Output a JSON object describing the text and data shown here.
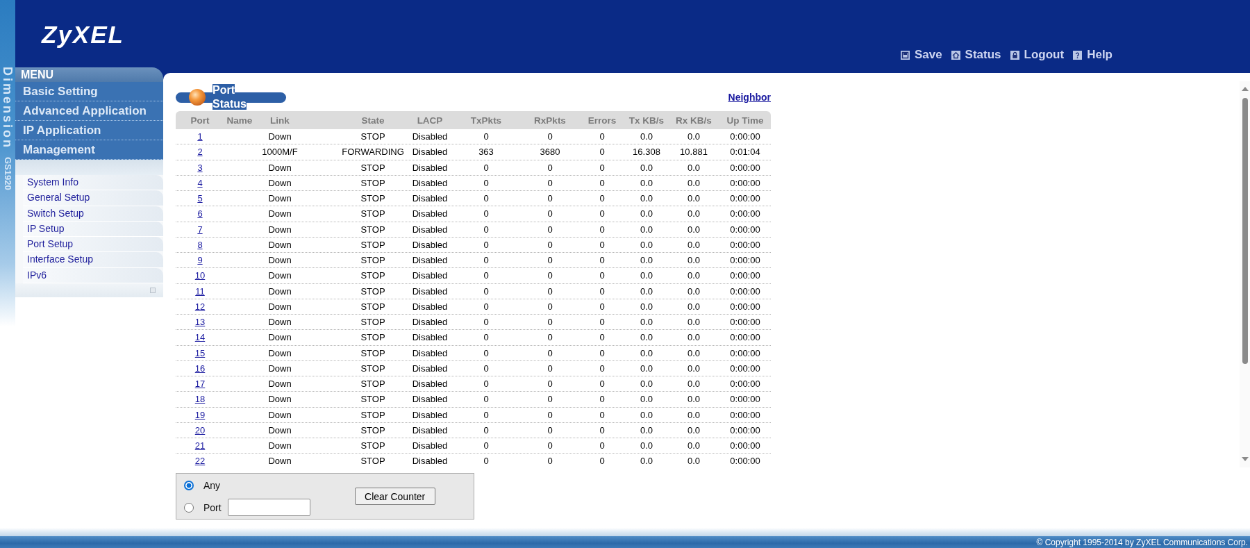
{
  "header": {
    "logo": "ZyXEL",
    "brand_strip": {
      "product": "Dimension",
      "model": "GS1920"
    },
    "actions": [
      {
        "kind": "save",
        "label": "Save"
      },
      {
        "kind": "status",
        "label": "Status"
      },
      {
        "kind": "logout",
        "label": "Logout"
      },
      {
        "kind": "help",
        "label": "Help"
      }
    ]
  },
  "sidebar": {
    "heading": "MENU",
    "sections": [
      "Basic Setting",
      "Advanced Application",
      "IP Application",
      "Management"
    ],
    "items": [
      "System Info",
      "General Setup",
      "Switch Setup",
      "IP Setup",
      "Port Setup",
      "Interface Setup",
      "IPv6"
    ]
  },
  "panel": {
    "title": "Port Status",
    "link": "Neighbor"
  },
  "table": {
    "columns": [
      "Port",
      "Name",
      "Link",
      "State",
      "LACP",
      "TxPkts",
      "RxPkts",
      "Errors",
      "Tx KB/s",
      "Rx KB/s",
      "Up Time"
    ],
    "rows": [
      {
        "port": "1",
        "link": "Down",
        "state": "STOP",
        "lacp": "Disabled",
        "tx_pkts": "0",
        "rx_pkts": "0",
        "errors": "0",
        "tx_kbs": "0.0",
        "rx_kbs": "0.0",
        "up_time": "0:00:00"
      },
      {
        "port": "2",
        "link": "1000M/F",
        "state": "FORWARDING",
        "lacp": "Disabled",
        "tx_pkts": "363",
        "rx_pkts": "3680",
        "errors": "0",
        "tx_kbs": "16.308",
        "rx_kbs": "10.881",
        "up_time": "0:01:04"
      },
      {
        "port": "3",
        "link": "Down",
        "state": "STOP",
        "lacp": "Disabled",
        "tx_pkts": "0",
        "rx_pkts": "0",
        "errors": "0",
        "tx_kbs": "0.0",
        "rx_kbs": "0.0",
        "up_time": "0:00:00"
      },
      {
        "port": "4",
        "link": "Down",
        "state": "STOP",
        "lacp": "Disabled",
        "tx_pkts": "0",
        "rx_pkts": "0",
        "errors": "0",
        "tx_kbs": "0.0",
        "rx_kbs": "0.0",
        "up_time": "0:00:00"
      },
      {
        "port": "5",
        "link": "Down",
        "state": "STOP",
        "lacp": "Disabled",
        "tx_pkts": "0",
        "rx_pkts": "0",
        "errors": "0",
        "tx_kbs": "0.0",
        "rx_kbs": "0.0",
        "up_time": "0:00:00"
      },
      {
        "port": "6",
        "link": "Down",
        "state": "STOP",
        "lacp": "Disabled",
        "tx_pkts": "0",
        "rx_pkts": "0",
        "errors": "0",
        "tx_kbs": "0.0",
        "rx_kbs": "0.0",
        "up_time": "0:00:00"
      },
      {
        "port": "7",
        "link": "Down",
        "state": "STOP",
        "lacp": "Disabled",
        "tx_pkts": "0",
        "rx_pkts": "0",
        "errors": "0",
        "tx_kbs": "0.0",
        "rx_kbs": "0.0",
        "up_time": "0:00:00"
      },
      {
        "port": "8",
        "link": "Down",
        "state": "STOP",
        "lacp": "Disabled",
        "tx_pkts": "0",
        "rx_pkts": "0",
        "errors": "0",
        "tx_kbs": "0.0",
        "rx_kbs": "0.0",
        "up_time": "0:00:00"
      },
      {
        "port": "9",
        "link": "Down",
        "state": "STOP",
        "lacp": "Disabled",
        "tx_pkts": "0",
        "rx_pkts": "0",
        "errors": "0",
        "tx_kbs": "0.0",
        "rx_kbs": "0.0",
        "up_time": "0:00:00"
      },
      {
        "port": "10",
        "link": "Down",
        "state": "STOP",
        "lacp": "Disabled",
        "tx_pkts": "0",
        "rx_pkts": "0",
        "errors": "0",
        "tx_kbs": "0.0",
        "rx_kbs": "0.0",
        "up_time": "0:00:00"
      },
      {
        "port": "11",
        "link": "Down",
        "state": "STOP",
        "lacp": "Disabled",
        "tx_pkts": "0",
        "rx_pkts": "0",
        "errors": "0",
        "tx_kbs": "0.0",
        "rx_kbs": "0.0",
        "up_time": "0:00:00"
      },
      {
        "port": "12",
        "link": "Down",
        "state": "STOP",
        "lacp": "Disabled",
        "tx_pkts": "0",
        "rx_pkts": "0",
        "errors": "0",
        "tx_kbs": "0.0",
        "rx_kbs": "0.0",
        "up_time": "0:00:00"
      },
      {
        "port": "13",
        "link": "Down",
        "state": "STOP",
        "lacp": "Disabled",
        "tx_pkts": "0",
        "rx_pkts": "0",
        "errors": "0",
        "tx_kbs": "0.0",
        "rx_kbs": "0.0",
        "up_time": "0:00:00"
      },
      {
        "port": "14",
        "link": "Down",
        "state": "STOP",
        "lacp": "Disabled",
        "tx_pkts": "0",
        "rx_pkts": "0",
        "errors": "0",
        "tx_kbs": "0.0",
        "rx_kbs": "0.0",
        "up_time": "0:00:00"
      },
      {
        "port": "15",
        "link": "Down",
        "state": "STOP",
        "lacp": "Disabled",
        "tx_pkts": "0",
        "rx_pkts": "0",
        "errors": "0",
        "tx_kbs": "0.0",
        "rx_kbs": "0.0",
        "up_time": "0:00:00"
      },
      {
        "port": "16",
        "link": "Down",
        "state": "STOP",
        "lacp": "Disabled",
        "tx_pkts": "0",
        "rx_pkts": "0",
        "errors": "0",
        "tx_kbs": "0.0",
        "rx_kbs": "0.0",
        "up_time": "0:00:00"
      },
      {
        "port": "17",
        "link": "Down",
        "state": "STOP",
        "lacp": "Disabled",
        "tx_pkts": "0",
        "rx_pkts": "0",
        "errors": "0",
        "tx_kbs": "0.0",
        "rx_kbs": "0.0",
        "up_time": "0:00:00"
      },
      {
        "port": "18",
        "link": "Down",
        "state": "STOP",
        "lacp": "Disabled",
        "tx_pkts": "0",
        "rx_pkts": "0",
        "errors": "0",
        "tx_kbs": "0.0",
        "rx_kbs": "0.0",
        "up_time": "0:00:00"
      },
      {
        "port": "19",
        "link": "Down",
        "state": "STOP",
        "lacp": "Disabled",
        "tx_pkts": "0",
        "rx_pkts": "0",
        "errors": "0",
        "tx_kbs": "0.0",
        "rx_kbs": "0.0",
        "up_time": "0:00:00"
      },
      {
        "port": "20",
        "link": "Down",
        "state": "STOP",
        "lacp": "Disabled",
        "tx_pkts": "0",
        "rx_pkts": "0",
        "errors": "0",
        "tx_kbs": "0.0",
        "rx_kbs": "0.0",
        "up_time": "0:00:00"
      },
      {
        "port": "21",
        "link": "Down",
        "state": "STOP",
        "lacp": "Disabled",
        "tx_pkts": "0",
        "rx_pkts": "0",
        "errors": "0",
        "tx_kbs": "0.0",
        "rx_kbs": "0.0",
        "up_time": "0:00:00"
      },
      {
        "port": "22",
        "link": "Down",
        "state": "STOP",
        "lacp": "Disabled",
        "tx_pkts": "0",
        "rx_pkts": "0",
        "errors": "0",
        "tx_kbs": "0.0",
        "rx_kbs": "0.0",
        "up_time": "0:00:00"
      }
    ]
  },
  "counter_form": {
    "options": [
      {
        "kind": "plain",
        "label": "Any",
        "selected": true
      },
      {
        "kind": "field",
        "label": "Port",
        "selected": false
      }
    ],
    "button": "Clear Counter"
  },
  "footer": {
    "copyright": "© Copyright 1995-2014 by ZyXEL Communications Corp."
  }
}
